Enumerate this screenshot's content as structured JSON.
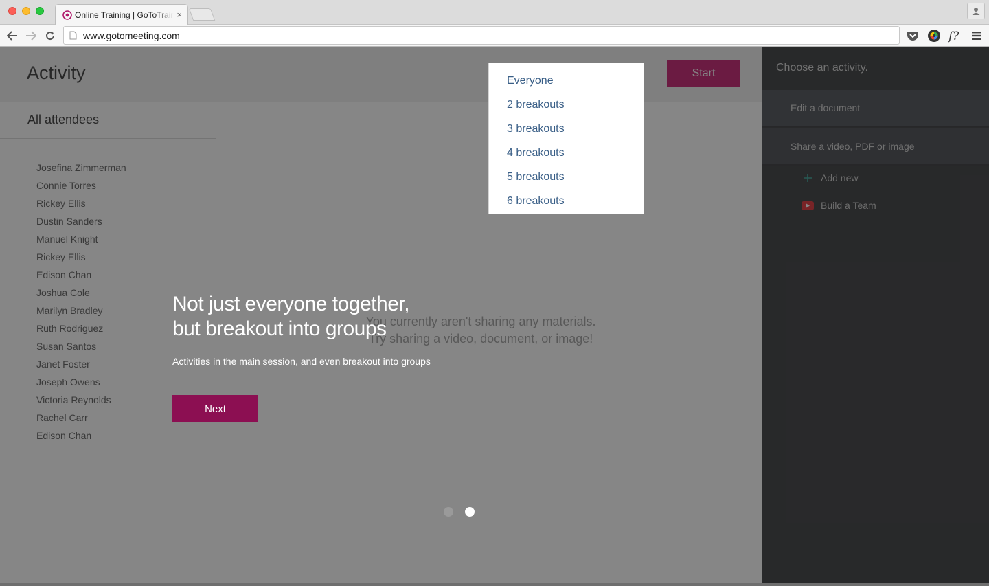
{
  "browser": {
    "tab_title": "Online Training | GoToTraining",
    "tab_close": "×",
    "url": "www.gotomeeting.com"
  },
  "app": {
    "page_title": "Activity",
    "start_label": "Start",
    "attendees": {
      "heading": "All attendees",
      "names": [
        "Josefina Zimmerman",
        "Connie Torres",
        "Rickey Ellis",
        "Dustin Sanders",
        "Manuel Knight",
        "Rickey Ellis",
        "Edison Chan",
        "Joshua Cole",
        "Marilyn Bradley",
        "Ruth Rodriguez",
        "Susan Santos",
        "Janet Foster",
        "Joseph Owens",
        "Victoria Reynolds",
        "Rachel Carr",
        "Edison Chan"
      ]
    },
    "empty_message": {
      "line1": "You currently aren't sharing any materials.",
      "line2": "Try sharing a video, document, or image!"
    },
    "group_dropdown": {
      "options": [
        "Everyone",
        "2 breakouts",
        "3 breakouts",
        "4 breakouts",
        "5 breakouts",
        "6 breakouts"
      ],
      "selected": "Everyone"
    },
    "activity_panel": {
      "title": "Choose an activity.",
      "edit_document": "Edit a document",
      "share_media": "Share a video, PDF or image",
      "add_new": "Add new",
      "media_item": "Build a Team"
    }
  },
  "coachmark": {
    "heading_line1": "Not just everyone together,",
    "heading_line2": "but breakout into groups",
    "subtext": "Activities in the main session, and even breakout into groups",
    "next_label": "Next",
    "pages_total": 2,
    "page_active": 2
  },
  "colors": {
    "brand_magenta": "#c41268",
    "next_button": "#8c0f52",
    "dropdown_text": "#3a5f87",
    "panel_dark": "#303134"
  }
}
